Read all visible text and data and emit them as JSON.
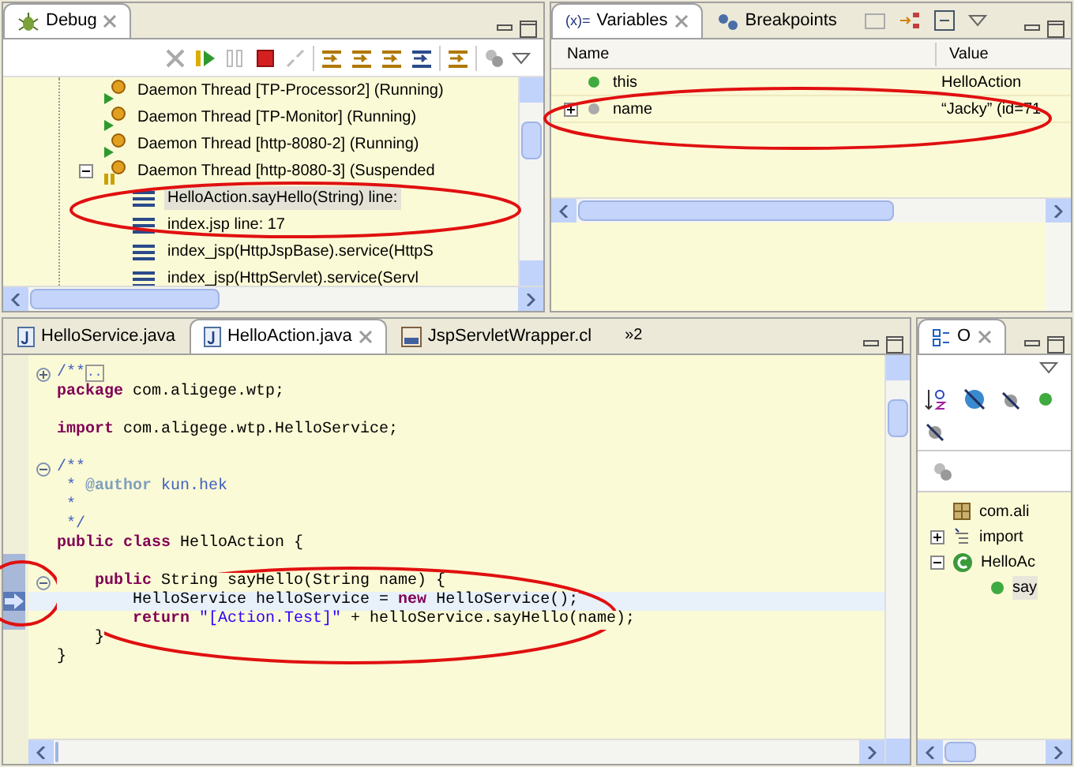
{
  "debug": {
    "tab": {
      "label": "Debug",
      "selected": true
    },
    "tree": [
      {
        "kind": "thread",
        "label": "Daemon Thread [TP-Processor2] (Running)"
      },
      {
        "kind": "thread",
        "label": "Daemon Thread [TP-Monitor] (Running)"
      },
      {
        "kind": "thread",
        "label": "Daemon Thread [http-8080-2] (Running)"
      },
      {
        "kind": "suspended",
        "label": "Daemon Thread [http-8080-3] (Suspended",
        "expanded": true
      },
      {
        "kind": "frame",
        "label": "HelloAction.sayHello(String) line:",
        "selected": true
      },
      {
        "kind": "frame",
        "label": "index.jsp line: 17",
        "selected": false
      },
      {
        "kind": "frame",
        "label": "index_jsp(HttpJspBase).service(HttpS",
        "selected": false
      },
      {
        "kind": "frame",
        "label": "index_jsp(HttpServlet).service(Servl",
        "selected": false
      }
    ]
  },
  "variables": {
    "tabs": [
      {
        "label": "Variables",
        "icon_label": "(x)=",
        "selected": true
      },
      {
        "label": "Breakpoints",
        "selected": false
      }
    ],
    "columns": [
      "Name",
      "Value"
    ],
    "rows": [
      {
        "kind": "field",
        "name": "this",
        "value": "HelloAction"
      },
      {
        "kind": "local",
        "name": "name",
        "value": "“Jacky” (id=71",
        "expanded": false
      }
    ]
  },
  "editor": {
    "tabs": [
      {
        "label": "HelloService.java",
        "selected": false,
        "kind": "java"
      },
      {
        "label": "HelloAction.java",
        "selected": true,
        "kind": "java"
      },
      {
        "label": "JspServletWrapper.cl",
        "selected": false,
        "kind": "class"
      }
    ],
    "overflow": "»2",
    "lines": [
      {
        "collapsed": true,
        "current": false,
        "segments": [
          {
            "kind": "comment",
            "text": "/**"
          },
          {
            "kind": "folded",
            "text": ".."
          }
        ]
      },
      {
        "current": false,
        "segments": [
          {
            "kind": "keyword",
            "text": "package "
          },
          {
            "kind": "plain",
            "text": "com.aligege.wtp;"
          }
        ]
      },
      {
        "current": false
      },
      {
        "current": false,
        "segments": [
          {
            "kind": "keyword",
            "text": "import "
          },
          {
            "kind": "plain",
            "text": "com.aligege.wtp.HelloService;"
          }
        ]
      },
      {
        "current": false
      },
      {
        "collapsed": false,
        "current": false,
        "segments": [
          {
            "kind": "comment",
            "text": "/**"
          }
        ]
      },
      {
        "current": false,
        "segments": [
          {
            "kind": "comment",
            "text": " * "
          },
          {
            "kind": "tag",
            "text": "@author"
          },
          {
            "kind": "comment",
            "text": " kun.hek"
          }
        ]
      },
      {
        "current": false,
        "segments": [
          {
            "kind": "comment",
            "text": " *"
          }
        ]
      },
      {
        "current": false,
        "segments": [
          {
            "kind": "comment",
            "text": " */"
          }
        ]
      },
      {
        "current": false,
        "segments": [
          {
            "kind": "keyword",
            "text": "public class "
          },
          {
            "kind": "plain",
            "text": "HelloAction {"
          }
        ]
      },
      {
        "current": false
      },
      {
        "collapsed": false,
        "current": false,
        "segments": [
          {
            "kind": "keyword",
            "text": "    public "
          },
          {
            "kind": "plain",
            "text": "String sayHello(String name) {"
          }
        ]
      },
      {
        "current": true,
        "segments": [
          {
            "kind": "plain",
            "text": "        HelloService helloService = "
          },
          {
            "kind": "keyword",
            "text": "new"
          },
          {
            "kind": "plain",
            "text": " HelloService();"
          }
        ]
      },
      {
        "current": false,
        "segments": [
          {
            "kind": "keyword",
            "text": "        return "
          },
          {
            "kind": "string",
            "text": "\"[Action.Test]\""
          },
          {
            "kind": "plain",
            "text": " + helloService.sayHello(name);"
          }
        ]
      },
      {
        "current": false,
        "segments": [
          {
            "kind": "plain",
            "text": "    }"
          }
        ]
      },
      {
        "current": false,
        "segments": [
          {
            "kind": "plain",
            "text": "}"
          }
        ]
      }
    ]
  },
  "outline": {
    "tab": {
      "label": "O",
      "selected": true
    },
    "tree": [
      {
        "kind": "package",
        "label": "com.ali"
      },
      {
        "kind": "imports",
        "label": "import",
        "expanded": false
      },
      {
        "kind": "class",
        "label": "HelloAc",
        "expanded": true,
        "children": [
          {
            "kind": "method",
            "label": "say"
          }
        ]
      }
    ]
  }
}
